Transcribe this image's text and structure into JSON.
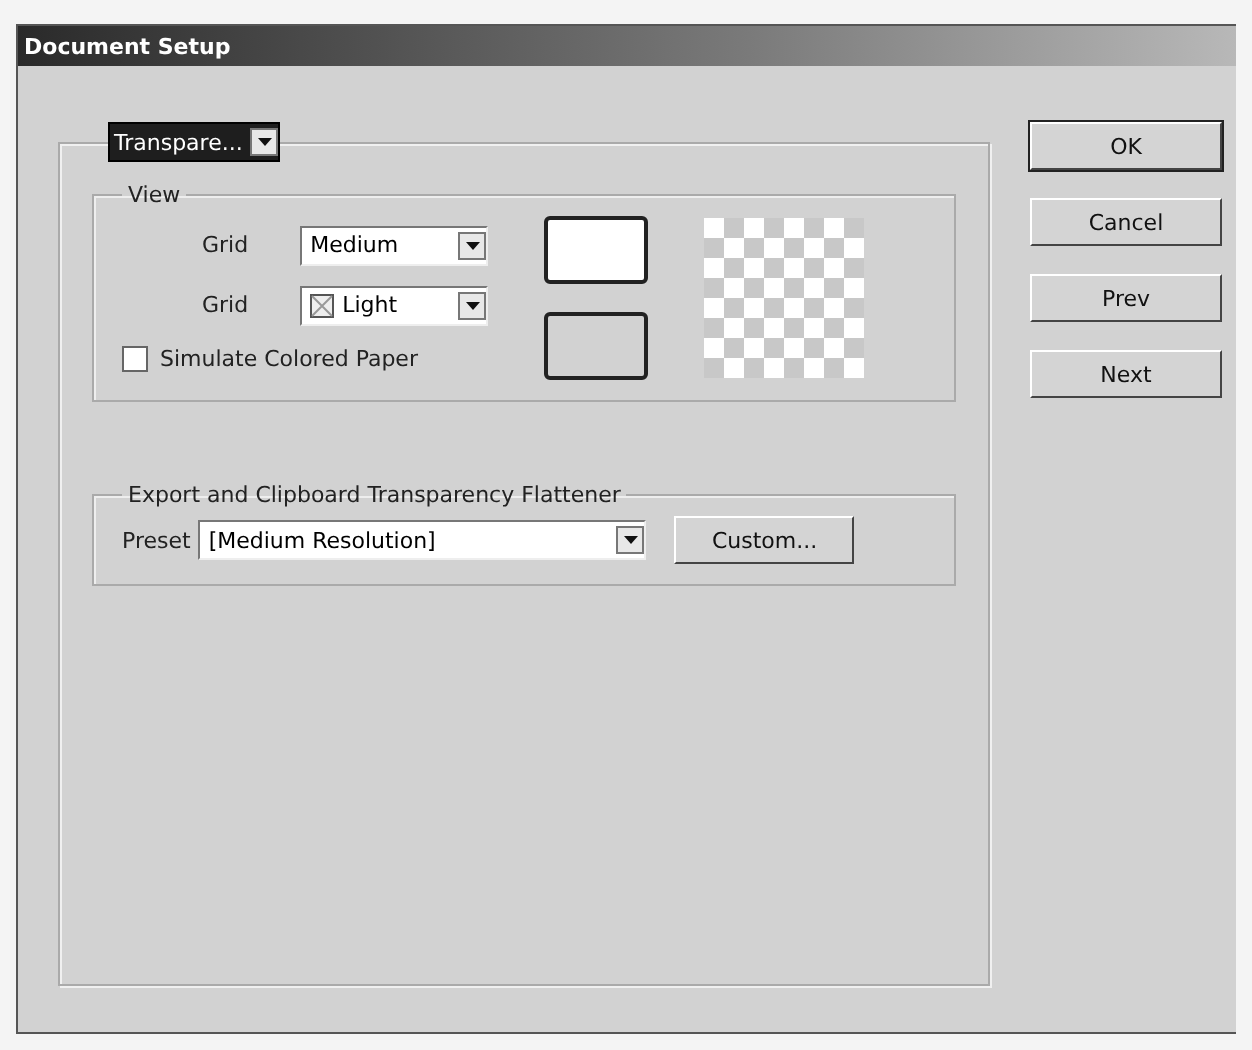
{
  "window": {
    "title": "Document Setup"
  },
  "section_menu": {
    "value": "Transpare..."
  },
  "view": {
    "legend": "View",
    "grid_size": {
      "label": "Grid",
      "value": "Medium"
    },
    "grid_colors": {
      "label": "Grid",
      "value": "Light"
    },
    "simulate_colored_paper": {
      "label": "Simulate Colored Paper",
      "checked": false
    }
  },
  "flattener": {
    "legend": "Export and Clipboard Transparency Flattener",
    "preset_label": "Preset",
    "preset": "[Medium Resolution]",
    "custom_button": "Custom..."
  },
  "buttons": [
    {
      "label": "OK",
      "default": true
    },
    {
      "label": "Cancel",
      "default": false
    },
    {
      "label": "Prev",
      "default": false
    },
    {
      "label": "Next",
      "default": false
    }
  ]
}
